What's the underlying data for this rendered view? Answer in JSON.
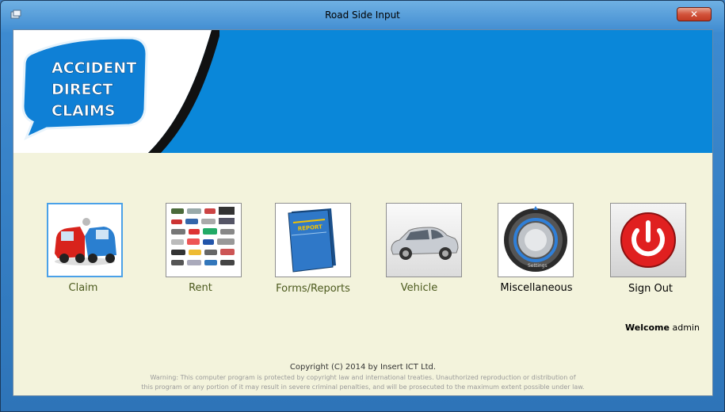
{
  "window": {
    "title": "Road Side Input",
    "close_label": "✕"
  },
  "banner": {
    "logo_lines": [
      "ACCIDENT",
      "DIRECT",
      "CLAIMS"
    ]
  },
  "menu": {
    "claim": "Claim",
    "rent": "Rent",
    "forms": "Forms/Reports",
    "vehicle": "Vehicle",
    "misc": "Miscellaneous",
    "signout": "Sign Out"
  },
  "report_book_text": "REPORT",
  "settings_text": "Settings",
  "welcome": {
    "prefix": "Welcome",
    "user": "admin"
  },
  "footer": {
    "copyright": "Copyright (C) 2014 by Insert ICT Ltd.",
    "warning_line1": "Warning: This computer program is protected by copyright law and international treaties.  Unauthorized reproduction or distribution of",
    "warning_line2": "this program or any portion of it may result in severe criminal penalties, and will be prosecuted to the maximum extent possible under law."
  },
  "colors": {
    "banner": "#0a87d9",
    "client_bg": "#f3f3dc",
    "label_green": "#4c5a1e",
    "signout_red": "#e02020"
  }
}
